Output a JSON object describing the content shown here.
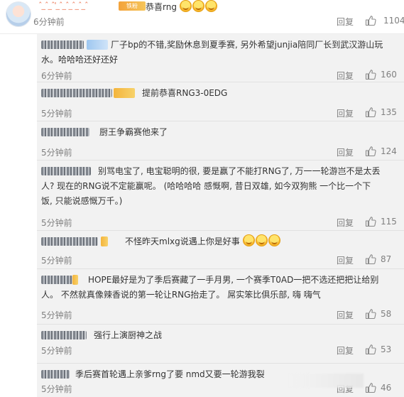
{
  "top_comment": {
    "name": "ˆ_ˆ_ˆ'_ˆ_ˆ_ˆ_ˆ_ˆ",
    "badge": "铁粉",
    "text": "恭喜rng",
    "emoji_count": 3,
    "time": "6分钟前",
    "reply": "回复",
    "likes": "1104"
  },
  "comments": [
    {
      "text": "厂子bp的不错,奖励休息到夏季赛, 另外希望junjia陪同厂长到武汉游山玩\n水。哈哈哈还好还好",
      "time": "6分钟前",
      "reply": "回复",
      "likes": "160"
    },
    {
      "text": "提前恭喜RNG3-0EDG",
      "time": "5分钟前",
      "reply": "回复",
      "likes": "135"
    },
    {
      "text": "厨王争霸赛他来了",
      "time": "5分钟前",
      "reply": "回复",
      "likes": "124"
    },
    {
      "text": "别骂电宝了, 电宝聪明的很, 要是赢了不能打RNG了, 万一一轮游岂不是太丢\n人? 现在的RNG说不定能赢呢。 (哈哈哈哈 感慨啊, 昔日双雄, 如今双狗熊 一个比一个下\n饭, 只能说感慨万千。)",
      "time": "5分钟前",
      "reply": "回复",
      "likes": "115"
    },
    {
      "text": "不怪昨天mlxg说遇上你是好事",
      "time": "5分钟前",
      "reply": "回复",
      "likes": "87"
    },
    {
      "text": "HOPE最好是为了季后赛藏了一手月男, 一个赛季T0AD一把不选还把把让给别\n人。 不然就真像辣香说的第一轮让RNG抬走了。 屌实笨比俱乐部, 嗨 嗨气",
      "time": "5分钟前",
      "reply": "回复",
      "likes": "58"
    },
    {
      "text": "强行上演厨神之战",
      "time": "5分钟前",
      "reply": "回复",
      "likes": "53"
    },
    {
      "text": "季后赛首轮遇上亲爹rng了要 nmd又要一轮游我裂",
      "time": "5分钟前",
      "reply": "回复",
      "likes": "46"
    }
  ],
  "icons": {
    "like": "thumbs-up-icon",
    "emoji": "grin-emoji-icon",
    "avatar": "anime-avatar"
  },
  "colors": {
    "nickname_orange": "#eb7350",
    "meta_gray": "#808080",
    "list_bg": "#f2f2f2",
    "vip_gold": "#f4b43c"
  }
}
